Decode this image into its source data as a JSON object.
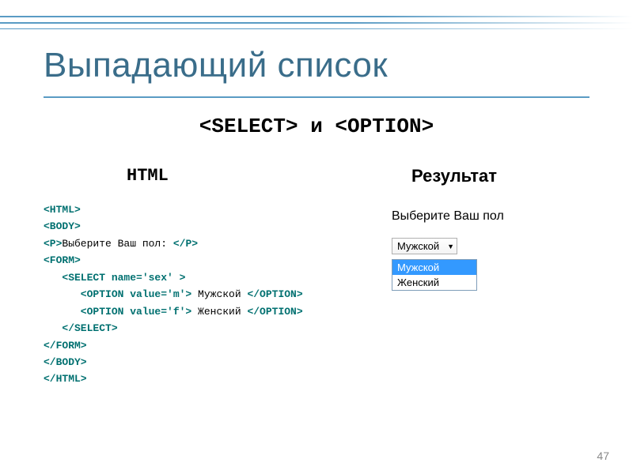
{
  "slide": {
    "title": "Выпадающий список",
    "subtitle": "<SELECT> и <OPTION>",
    "col_html": "HTML",
    "col_result": "Результат",
    "page_number": "47"
  },
  "code": {
    "l1": "<HTML>",
    "l2": "<BODY>",
    "l3a": "<P>",
    "l3b": "Выберите Ваш пол: ",
    "l3c": "</P>",
    "l4": "<FORM>",
    "l5": "   <SELECT name='sex' >",
    "l6a": "      <OPTION value='m'>",
    "l6b": " Мужской ",
    "l6c": "</OPTION>",
    "l7a": "      <OPTION value='f'>",
    "l7b": " Женский ",
    "l7c": "</OPTION>",
    "l8": "   </SELECT>",
    "l9": "</FORM>",
    "l10": "</BODY>",
    "l11": "</HTML>"
  },
  "result": {
    "label": "Выберите Ваш пол",
    "selected": "Мужской",
    "options": {
      "opt1": "Мужской",
      "opt2": "Женский"
    }
  }
}
